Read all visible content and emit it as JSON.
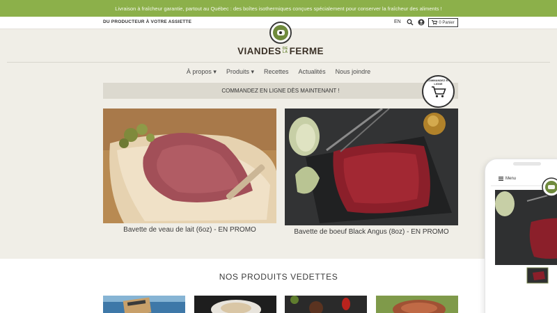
{
  "announcement": "Livraison à fraîcheur garantie, partout au Québec : des boîtes isothermiques conçues spécialement pour conserver la fraîcheur des aliments !",
  "topbar": {
    "tagline": "DU PRODUCTEUR À VOTRE ASSIETTE",
    "lang": "EN",
    "cart_label": "0 Panier"
  },
  "logo": {
    "word1": "VIANDES",
    "small_top": "DE",
    "small_bottom": "LA",
    "word2": "FERME"
  },
  "nav": {
    "items": [
      "À propos",
      "Produits",
      "Recettes",
      "Actualités",
      "Nous joindre"
    ]
  },
  "order_banner": "COMMANDEZ EN LIGNE DÈS MAINTENANT !",
  "stamp_text": "COMMANDEZ EN LIGNE",
  "products": [
    {
      "label": "Bavette de veau de lait (6oz) - EN PROMO"
    },
    {
      "label": "Bavette de boeuf Black Angus (8oz) - EN PROMO"
    }
  ],
  "featured": {
    "title": "NOS PRODUITS VEDETTES"
  },
  "phone": {
    "menu_label": "Menu"
  },
  "colors": {
    "announcement_bg": "#8cb04a",
    "page_bg": "#f0eee7",
    "order_bar_bg": "#dcd9cf"
  },
  "icons": {
    "search": "search-icon",
    "account": "user-icon",
    "cart": "cart-icon",
    "menu": "hamburger-icon"
  }
}
